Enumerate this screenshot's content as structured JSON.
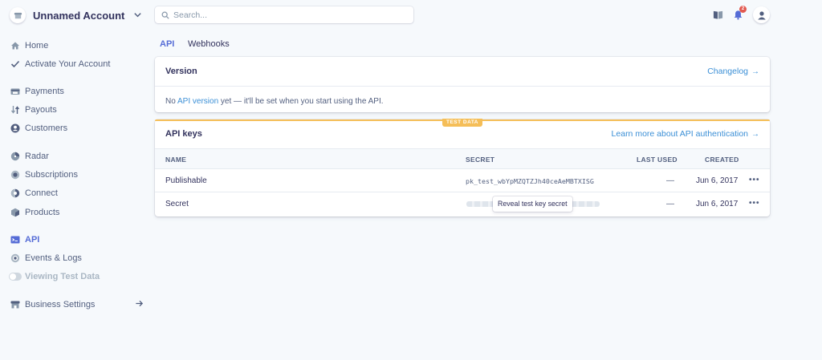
{
  "account": {
    "name": "Unnamed Account"
  },
  "search": {
    "placeholder": "Search..."
  },
  "sidebar": {
    "groups": [
      [
        {
          "label": "Home",
          "icon": "home-icon"
        },
        {
          "label": "Activate Your Account",
          "icon": "check-icon"
        }
      ],
      [
        {
          "label": "Payments",
          "icon": "payments-icon"
        },
        {
          "label": "Payouts",
          "icon": "payouts-icon"
        },
        {
          "label": "Customers",
          "icon": "customers-icon"
        }
      ],
      [
        {
          "label": "Radar",
          "icon": "radar-icon"
        },
        {
          "label": "Subscriptions",
          "icon": "subscriptions-icon"
        },
        {
          "label": "Connect",
          "icon": "connect-icon"
        },
        {
          "label": "Products",
          "icon": "products-icon"
        }
      ],
      [
        {
          "label": "API",
          "icon": "api-icon",
          "active": true
        },
        {
          "label": "Events & Logs",
          "icon": "events-icon"
        },
        {
          "label": "Viewing Test Data",
          "icon": "toggle-icon",
          "muted": true
        }
      ],
      [
        {
          "label": "Business Settings",
          "icon": "business-settings-icon"
        }
      ]
    ]
  },
  "header": {
    "notification_count": "2"
  },
  "tabs": [
    {
      "label": "API",
      "active": true
    },
    {
      "label": "Webhooks",
      "active": false
    }
  ],
  "version_card": {
    "title": "Version",
    "changelog_label": "Changelog",
    "text_before": "No ",
    "text_link": "API version",
    "text_after": " yet — it'll be set when you start using the API."
  },
  "keys_card": {
    "badge": "TEST DATA",
    "title": "API keys",
    "learn_more": "Learn more about API authentication",
    "columns": {
      "name": "NAME",
      "secret": "SECRET",
      "last_used": "LAST USED",
      "created": "CREATED"
    },
    "rows": [
      {
        "name": "Publishable",
        "secret": "pk_test_wbYpMZQTZJh40ceAeMBTXISG",
        "last_used": "—",
        "created": "Jun 6, 2017"
      },
      {
        "name": "Secret",
        "reveal_label": "Reveal test key secret",
        "last_used": "—",
        "created": "Jun 6, 2017"
      }
    ]
  },
  "colors": {
    "accent": "#556cd6",
    "link": "#3b8fd6",
    "test_data": "#f5be58"
  }
}
